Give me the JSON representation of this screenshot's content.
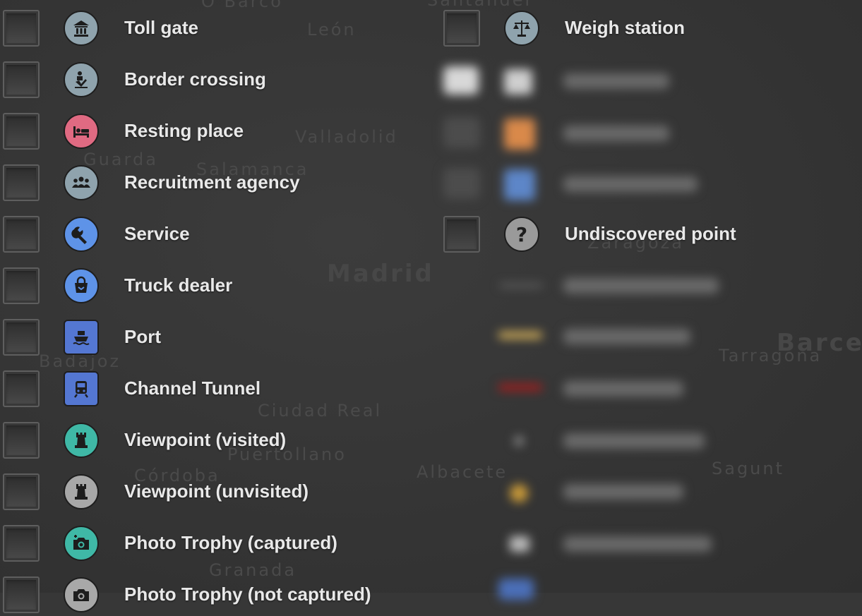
{
  "left_column": [
    {
      "label": "Toll gate",
      "icon": "toll-gate-icon",
      "color": "#8fa3ad"
    },
    {
      "label": "Border crossing",
      "icon": "border-crossing-icon",
      "color": "#8fa3ad"
    },
    {
      "label": "Resting place",
      "icon": "bed-icon",
      "color": "#e06a82"
    },
    {
      "label": "Recruitment agency",
      "icon": "people-icon",
      "color": "#8fa3ad"
    },
    {
      "label": "Service",
      "icon": "wrench-icon",
      "color": "#5e93e8"
    },
    {
      "label": "Truck dealer",
      "icon": "shopping-bag-icon",
      "color": "#5e93e8"
    },
    {
      "label": "Port",
      "icon": "ship-icon",
      "color": "#5477d2"
    },
    {
      "label": "Channel Tunnel",
      "icon": "train-icon",
      "color": "#5477d2"
    },
    {
      "label": "Viewpoint (visited)",
      "icon": "tower-icon",
      "color": "#3fb8a6"
    },
    {
      "label": "Viewpoint (unvisited)",
      "icon": "tower-icon",
      "color": "#a8a8a8"
    },
    {
      "label": "Photo Trophy (captured)",
      "icon": "camera-icon",
      "color": "#3fb8a6"
    },
    {
      "label": "Photo Trophy (not captured)",
      "icon": "camera-icon",
      "color": "#a8a8a8"
    }
  ],
  "right_column": {
    "weigh_station": {
      "label": "Weigh station",
      "icon": "scales-icon",
      "color": "#8fa3ad"
    },
    "undiscovered_point": {
      "label": "Undiscovered point",
      "icon": "question-icon",
      "symbol": "?",
      "color": "#9a9a9a"
    }
  },
  "map_labels": [
    "O Barco",
    "Santander",
    "León",
    "Valladolid",
    "Salamanca",
    "Guarda",
    "Madrid",
    "Badajoz",
    "Ciudad Real",
    "Puertollano",
    "Córdoba",
    "Granada",
    "Albacete",
    "Tarragona",
    "Barcelona",
    "Sagunt",
    "Zaragoza"
  ],
  "colors": {
    "background": "#373737",
    "text": "#e9e9e9",
    "checkbox_border": "#5e5e5e"
  }
}
